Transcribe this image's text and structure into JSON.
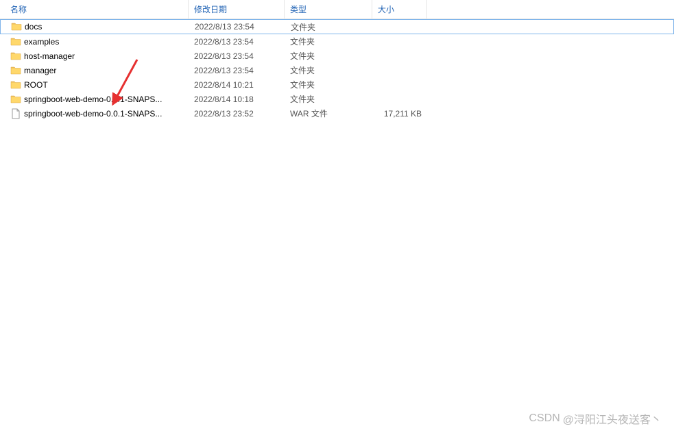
{
  "columns": {
    "name": "名称",
    "date": "修改日期",
    "type": "类型",
    "size": "大小"
  },
  "files": [
    {
      "name": "docs",
      "date": "2022/8/13 23:54",
      "type": "文件夹",
      "size": "",
      "icon": "folder",
      "selected": true
    },
    {
      "name": "examples",
      "date": "2022/8/13 23:54",
      "type": "文件夹",
      "size": "",
      "icon": "folder",
      "selected": false
    },
    {
      "name": "host-manager",
      "date": "2022/8/13 23:54",
      "type": "文件夹",
      "size": "",
      "icon": "folder",
      "selected": false
    },
    {
      "name": "manager",
      "date": "2022/8/13 23:54",
      "type": "文件夹",
      "size": "",
      "icon": "folder",
      "selected": false
    },
    {
      "name": "ROOT",
      "date": "2022/8/14 10:21",
      "type": "文件夹",
      "size": "",
      "icon": "folder",
      "selected": false
    },
    {
      "name": "springboot-web-demo-0.0.1-SNAPS...",
      "date": "2022/8/14 10:18",
      "type": "文件夹",
      "size": "",
      "icon": "folder",
      "selected": false
    },
    {
      "name": "springboot-web-demo-0.0.1-SNAPS...",
      "date": "2022/8/13 23:52",
      "type": "WAR 文件",
      "size": "17,211 KB",
      "icon": "file",
      "selected": false
    }
  ],
  "watermark": {
    "brand": "CSDN",
    "author": "@浔阳江头夜送客丶"
  }
}
